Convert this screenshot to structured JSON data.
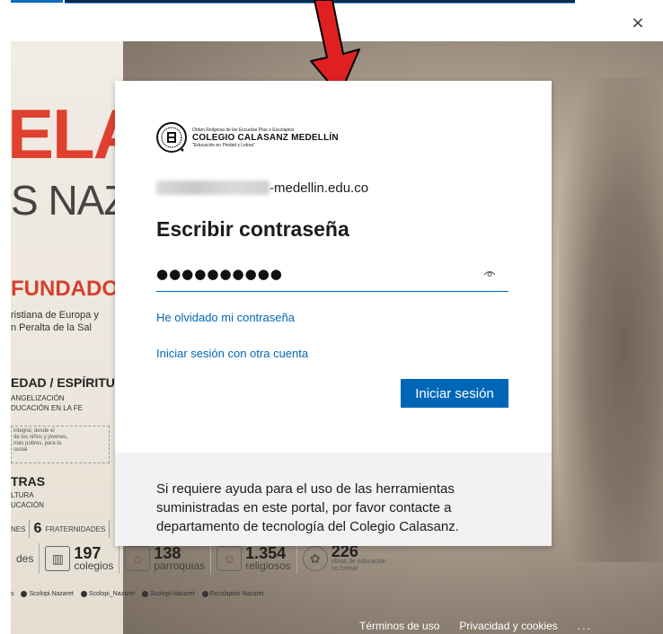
{
  "window": {
    "close_label": "×"
  },
  "poster": {
    "headline_red": "ELAS",
    "headline_gray": "S NAZA",
    "fundador": "FUNDADOR",
    "fundador_lines": [
      "ristiana de Europa y",
      "n Peralta de la Sal"
    ],
    "piedad": "EDAD / ESPÍRITU",
    "piedad_lines": [
      "ANGELIZACIÓN",
      "DUCACIÓN EN LA FE"
    ],
    "small_box_lines": [
      "integral, desde el",
      "de los niños y jóvenes,",
      "más pobres, para la",
      "social"
    ],
    "letras": "TRAS",
    "letras_lines": [
      "LTURA",
      "UCACIÓN"
    ],
    "stat_row": {
      "a": "NES",
      "num": "6",
      "b": "FRATERNIDADES"
    },
    "numbers": [
      {
        "prefix": "des",
        "value": "197",
        "label": "colegios"
      },
      {
        "value": "138",
        "label": "parroquias"
      },
      {
        "value": "1.354",
        "label": "religiosos"
      },
      {
        "value": "226",
        "label": "obras de educación",
        "label2": "no formal"
      }
    ],
    "social": [
      "s",
      "Scolopi.Nazaret",
      "Scolopi_Nazaret",
      "Scolopi.Nazaret",
      "Escolapios Nazaret"
    ]
  },
  "dialog": {
    "logo": {
      "line1": "Orden Religiosa de las Escuelas Pías o Escolapios",
      "line2": "COLEGIO CALASANZ MEDELLÍN",
      "line3": "\"Educación en Piedad y Letras\""
    },
    "email_domain": "-medellin.edu.co",
    "title": "Escribir contraseña",
    "password_value": "●●●●●●●●●●",
    "forgot_link": "He olvidado mi contraseña",
    "other_account_link": "Iniciar sesión con otra cuenta",
    "signin_button": "Iniciar sesión",
    "help_text": "Si requiere ayuda para el uso de las herramientas suministradas en este portal, por favor contacte a departamento de tecnología del Colegio Calasanz."
  },
  "footer": {
    "terms": "Términos de uso",
    "privacy": "Privacidad y cookies",
    "more": "..."
  },
  "colors": {
    "accent": "#0067b8",
    "annotation_arrow": "#e02020",
    "poster_red": "#e0402f"
  },
  "icons": [
    "close-icon",
    "eye-icon",
    "arrow-annotation",
    "school-seal-logo"
  ]
}
